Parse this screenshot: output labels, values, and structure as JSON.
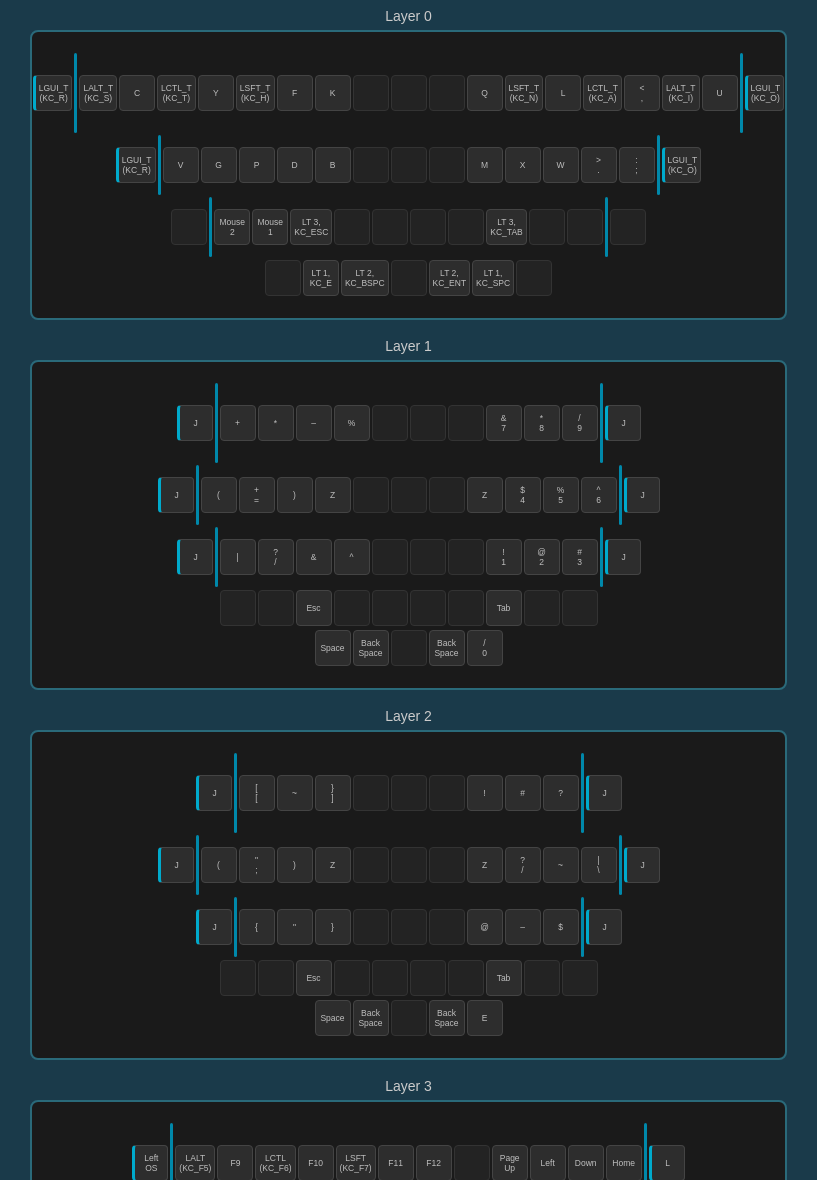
{
  "layers": [
    {
      "title": "Layer 0",
      "id": "layer0"
    },
    {
      "title": "Layer 1",
      "id": "layer1"
    },
    {
      "title": "Layer 2",
      "id": "layer2"
    },
    {
      "title": "Layer 3",
      "id": "layer3"
    }
  ]
}
